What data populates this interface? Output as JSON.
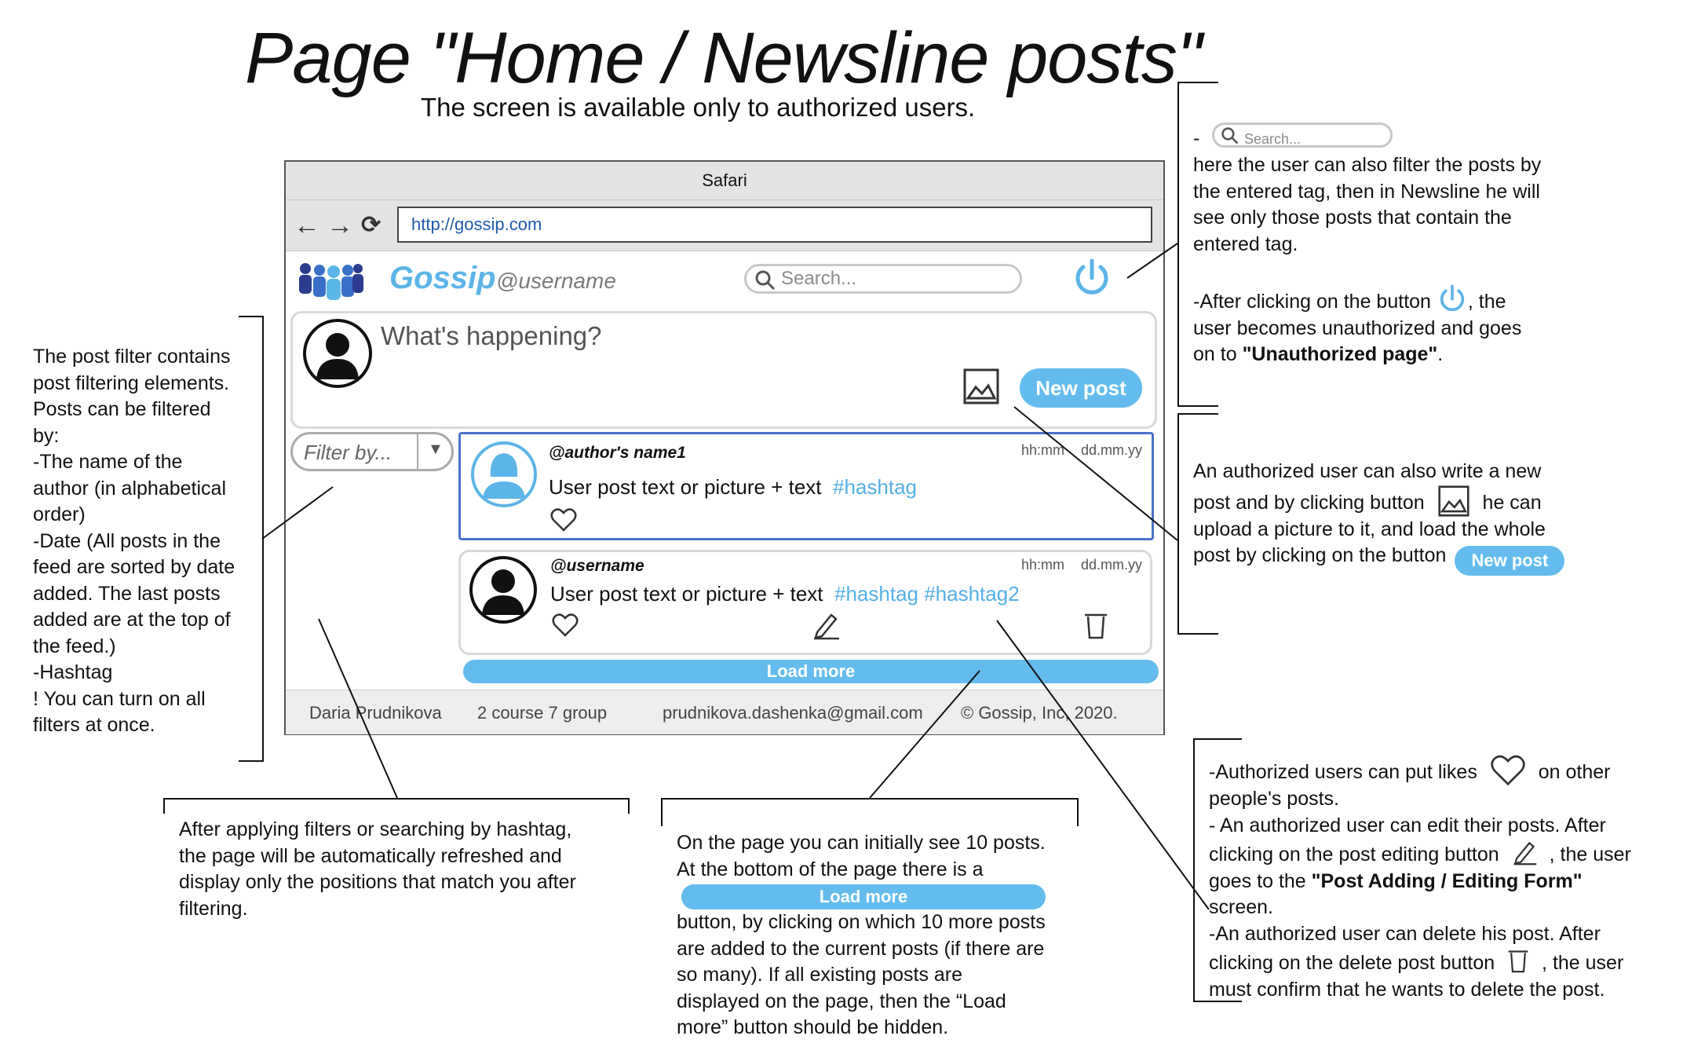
{
  "page": {
    "title": "Page \"Home / Newsline posts\"",
    "subtitle": "The screen is available only to authorized users."
  },
  "browser": {
    "window_title": "Safari",
    "url": "http://gossip.com"
  },
  "app": {
    "logo_text": "Gossip",
    "username": "@username",
    "search_placeholder": "Search...",
    "compose_placeholder": "What's happening?",
    "new_post_label": "New post",
    "filter_placeholder": "Filter by...",
    "load_more_label": "Load more",
    "posts": [
      {
        "author": "@author's name1",
        "time": "hh:mm",
        "date": "dd.mm.yy",
        "text": "User post text or picture + text",
        "tags": "#hashtag"
      },
      {
        "author": "@username",
        "time": "hh:mm",
        "date": "dd.mm.yy",
        "text": "User post text or picture + text",
        "tags": "#hashtag #hashtag2"
      }
    ],
    "footer": {
      "name": "Daria Prudnikova",
      "group": "2 course 7 group",
      "email": "prudnikova.dashenka@gmail.com",
      "copyright": "© Gossip, Inc, 2020."
    }
  },
  "notes": {
    "filter": [
      "The post filter contains",
      "post filtering elements.",
      "Posts can be filtered",
      "by:",
      "-The name of the",
      "author (in alphabetical",
      "order)",
      "-Date (All posts in the",
      "feed are sorted by date",
      "added. The last posts",
      "added are at the top of",
      "the feed.)",
      "-Hashtag",
      "! You can turn on all",
      "filters at once."
    ],
    "search": {
      "dash": "-",
      "search_placeholder": "Search...",
      "lines": [
        "here the user can also filter the posts by",
        "the entered tag, then in Newsline he will",
        "see only those posts that contain the",
        "entered tag."
      ],
      "logout_pre": "-After clicking on the button",
      "logout_post": ", the",
      "logout_line2": "user becomes unauthorized and goes",
      "logout_line3_pre": "on to ",
      "logout_line3_bold": "\"Unauthorized page\"",
      "logout_line3_post": "."
    },
    "newpost": {
      "line1": "An authorized user can also write a new",
      "line2_pre": "post and by clicking button",
      "line2_post": "he can",
      "line3": "upload a picture to it, and load the whole",
      "line4": "post by clicking on the button",
      "button": "New post"
    },
    "refresh": [
      "After applying filters or searching by hashtag,",
      "the page will be automatically refreshed and",
      "display only the positions that match you after",
      "filtering."
    ],
    "loadmore": {
      "line1": "On the page you can initially see 10 posts.",
      "line2": "At the bottom of the page there is a",
      "button": "Load more",
      "rest": [
        "button, by clicking on which 10 more posts",
        "are added to the current posts (if there are",
        "so many). If all existing posts are",
        "displayed on the page, then the “Load",
        "more” button should be hidden."
      ]
    },
    "actions": {
      "like_pre": "-Authorized users can put likes",
      "like_post": "on other",
      "like_line2": "people's posts.",
      "edit_line1": "- An authorized user can edit their posts. After",
      "edit_line2_pre": "clicking on the post editing button",
      "edit_line2_post": ", the user",
      "edit_line3_pre": "goes to the ",
      "edit_line3_bold": "\"Post Adding / Editing Form\"",
      "edit_line4": "screen.",
      "del_line1": "-An authorized user can delete his post. After",
      "del_line2_pre": "clicking on the delete post button",
      "del_line2_post": ", the user",
      "del_line3": "must confirm that he wants to delete the post."
    }
  }
}
